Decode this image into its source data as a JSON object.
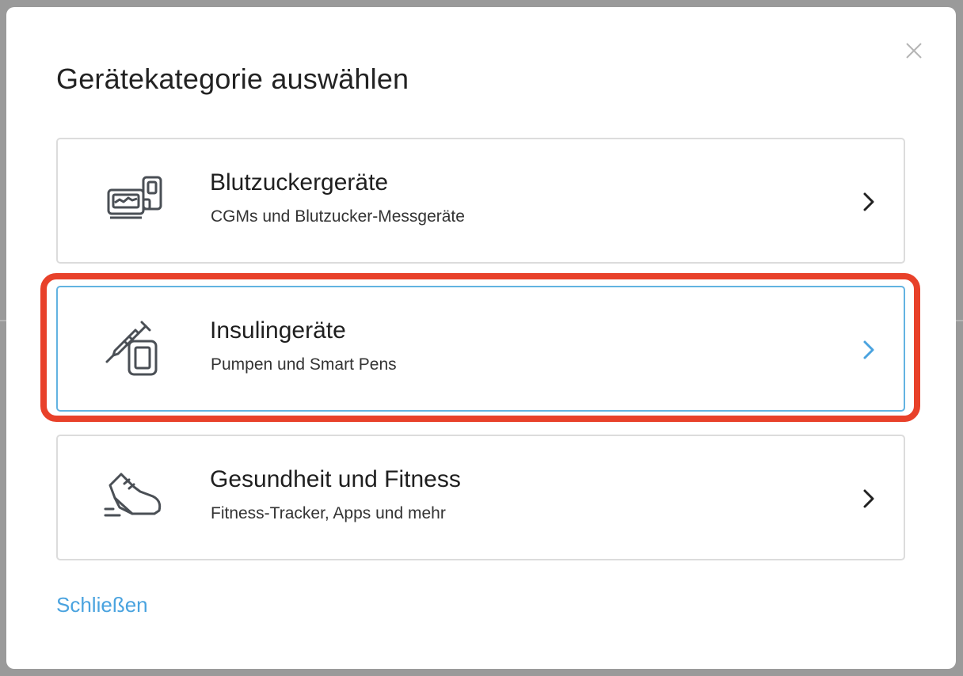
{
  "dialog": {
    "title": "Gerätekategorie auswählen",
    "close_icon": "close-icon",
    "close_link": "Schließen"
  },
  "categories": [
    {
      "title": "Blutzuckergeräte",
      "subtitle": "CGMs und Blutzucker-Messgeräte",
      "icon": "glucose-meter-icon",
      "selected": false
    },
    {
      "title": "Insulingeräte",
      "subtitle": "Pumpen und Smart Pens",
      "icon": "insulin-device-icon",
      "selected": true
    },
    {
      "title": "Gesundheit und Fitness",
      "subtitle": "Fitness-Tracker, Apps und mehr",
      "icon": "sneaker-icon",
      "selected": false
    }
  ],
  "colors": {
    "accent": "#4aa3df",
    "selected_border": "#62b3e1",
    "highlight": "#e8412a",
    "icon_stroke": "#4a4f55"
  }
}
